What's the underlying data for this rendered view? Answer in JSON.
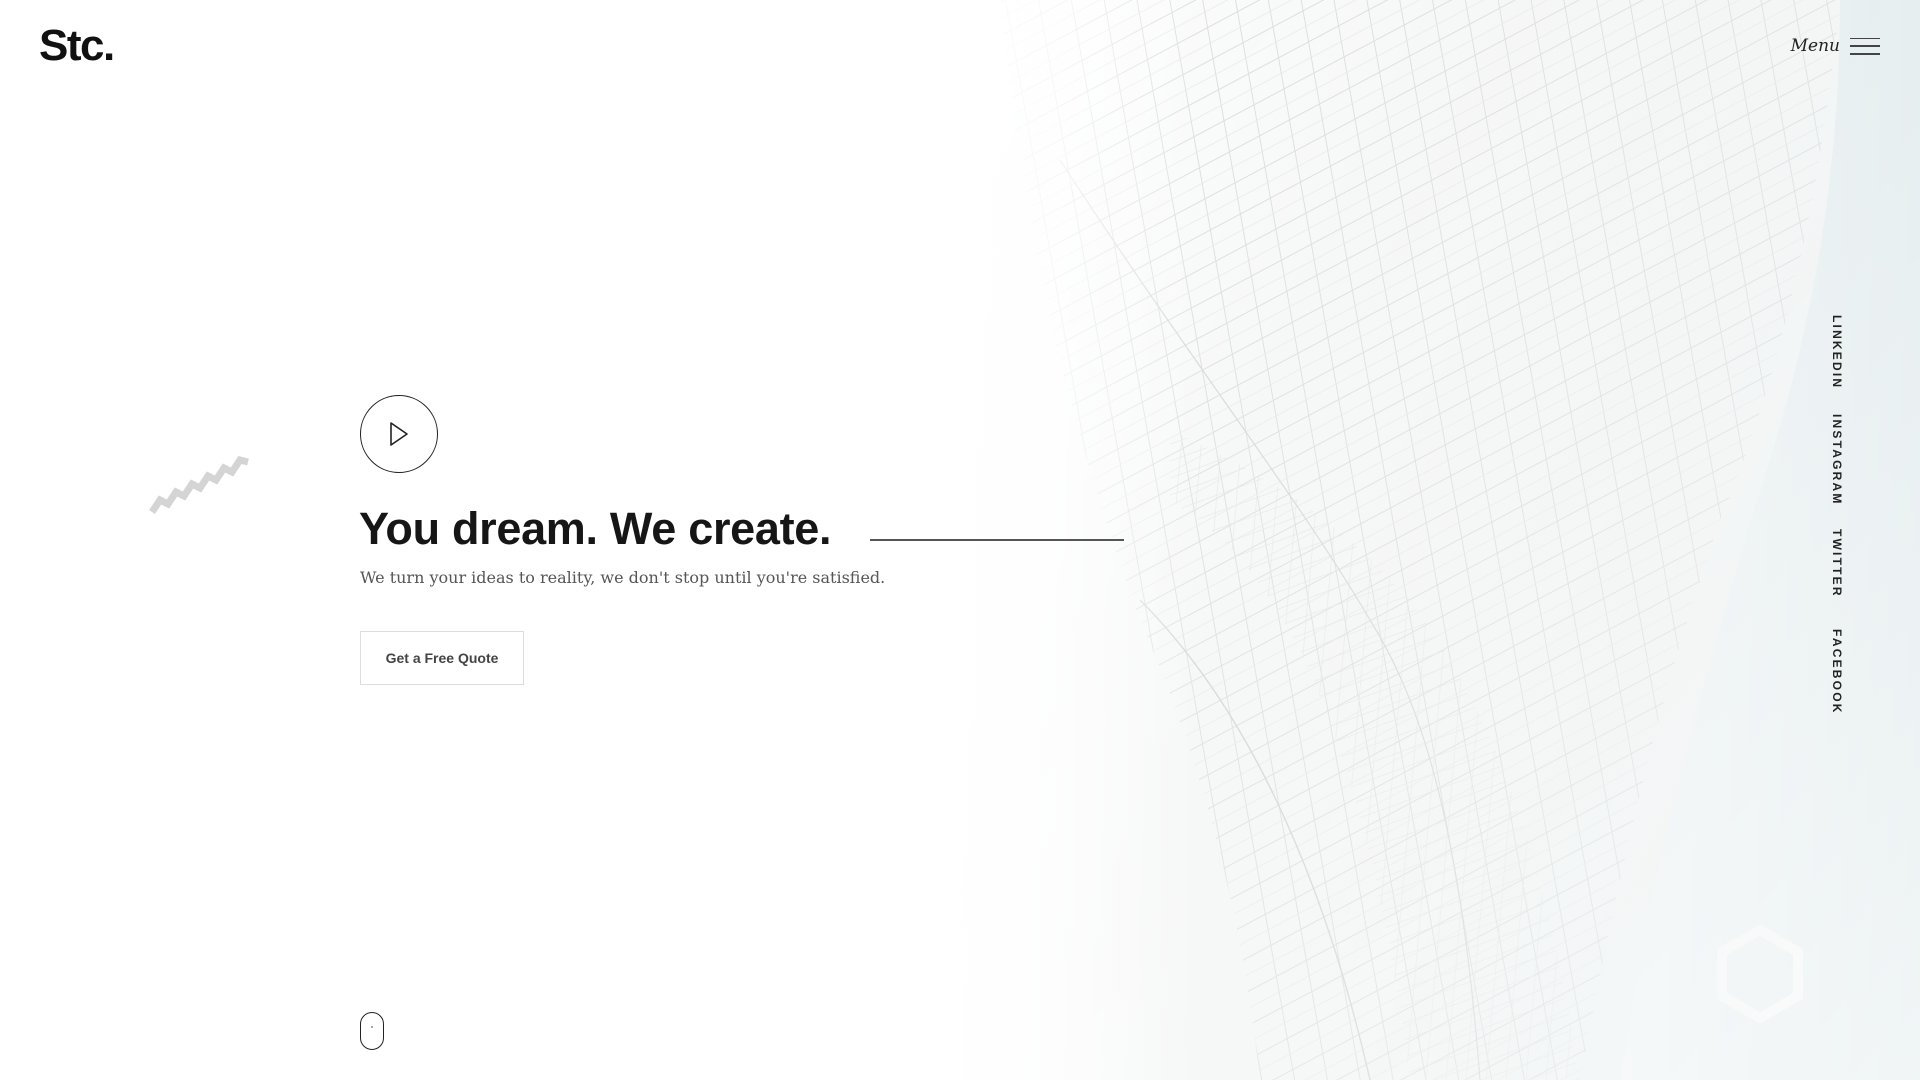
{
  "header": {
    "logo_text": "Stc.",
    "menu_label": "Menu",
    "menu_icon": "hamburger-icon"
  },
  "hero": {
    "play_icon": "play-icon",
    "headline": "You dream. We create.",
    "subheadline": "We turn your ideas to reality, we don't stop until you're satisfied.",
    "cta_label": "Get a Free Quote"
  },
  "social": {
    "links": [
      {
        "label": "LINKEDIN"
      },
      {
        "label": "INSTAGRAM"
      },
      {
        "label": "TWITTER"
      },
      {
        "label": "FACEBOOK"
      }
    ]
  },
  "scroll_indicator_icon": "mouse-scroll-icon",
  "colors": {
    "background": "#ffffff",
    "text_primary": "#161616",
    "text_secondary": "#555555",
    "button_border": "#dcdcdc",
    "decoration": "#d6d6d6"
  }
}
